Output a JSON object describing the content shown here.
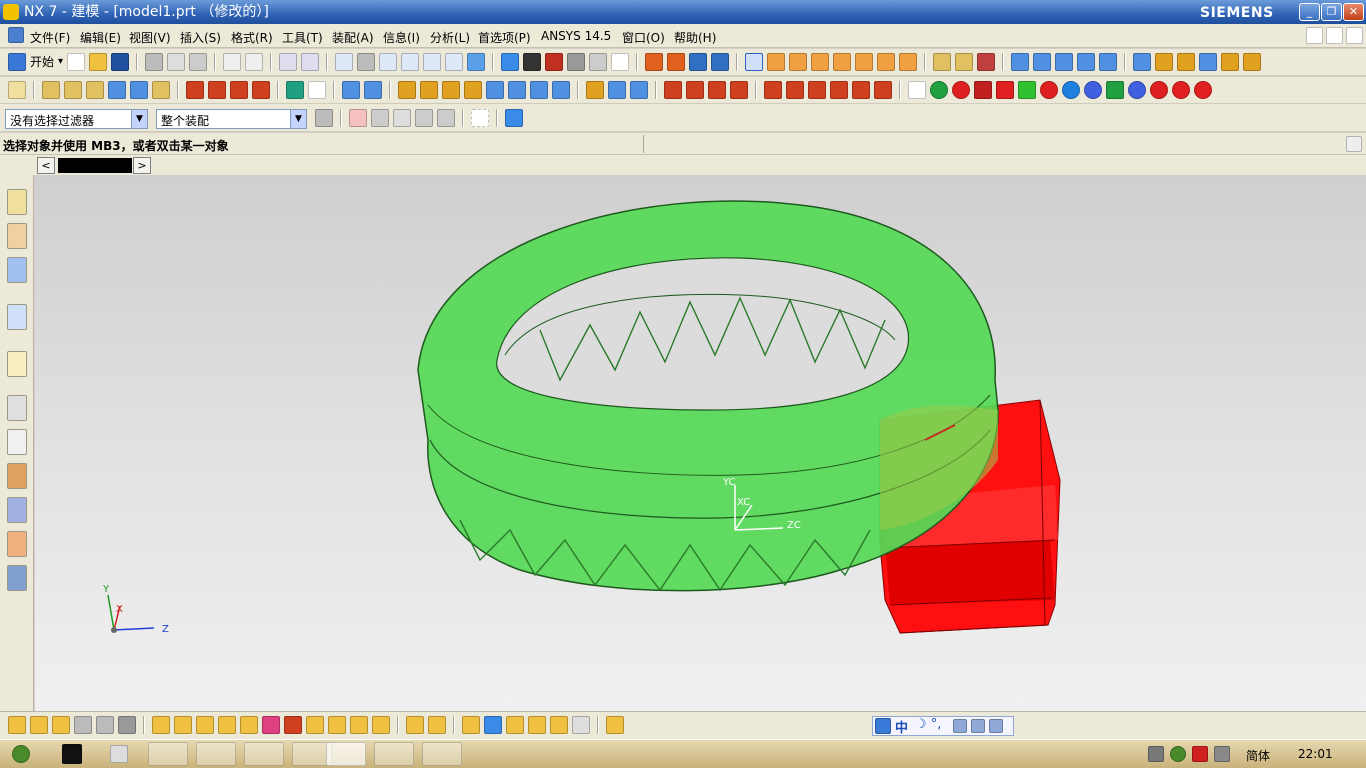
{
  "window": {
    "title": "NX 7 - 建模 - [model1.prt （修改的）]",
    "brand": "SIEMENS",
    "controls": [
      "_",
      "❐",
      "✕"
    ]
  },
  "menu": {
    "items": [
      "文件(F)",
      "编辑(E)",
      "视图(V)",
      "插入(S)",
      "格式(R)",
      "工具(T)",
      "装配(A)",
      "信息(I)",
      "分析(L)",
      "首选项(P)",
      "ANSYS 14.5",
      "窗口(O)",
      "帮助(H)"
    ]
  },
  "toolbar": {
    "start_label": "开始",
    "start_arrow": "▾"
  },
  "filter": {
    "selection_filter": "没有选择过滤器",
    "assembly_scope": "整个装配"
  },
  "status": {
    "prompt": "选择对象并使用 MB3，或者双击某一对象"
  },
  "navigation": {
    "prev": "<",
    "next": ">"
  },
  "viewport": {
    "wcs_labels": {
      "x": "XC",
      "y": "YC",
      "z": "ZC"
    },
    "abs_labels": {
      "x": "X",
      "y": "Y",
      "z": "Z"
    },
    "gear_ring_color": "#55d955",
    "pinion_color": "#ff1010",
    "background_top": "#cfcfcf",
    "background_bottom": "#f0f0f0"
  },
  "ime": {
    "mode": "中",
    "symbols": "☽ °,"
  },
  "taskbar": {
    "tray_language": "简体",
    "clock": "22:01"
  },
  "colors": {
    "titlebar": "#2f63b5",
    "toolbar_bg": "#ece9d8",
    "taskbar": "#c9b27a"
  }
}
